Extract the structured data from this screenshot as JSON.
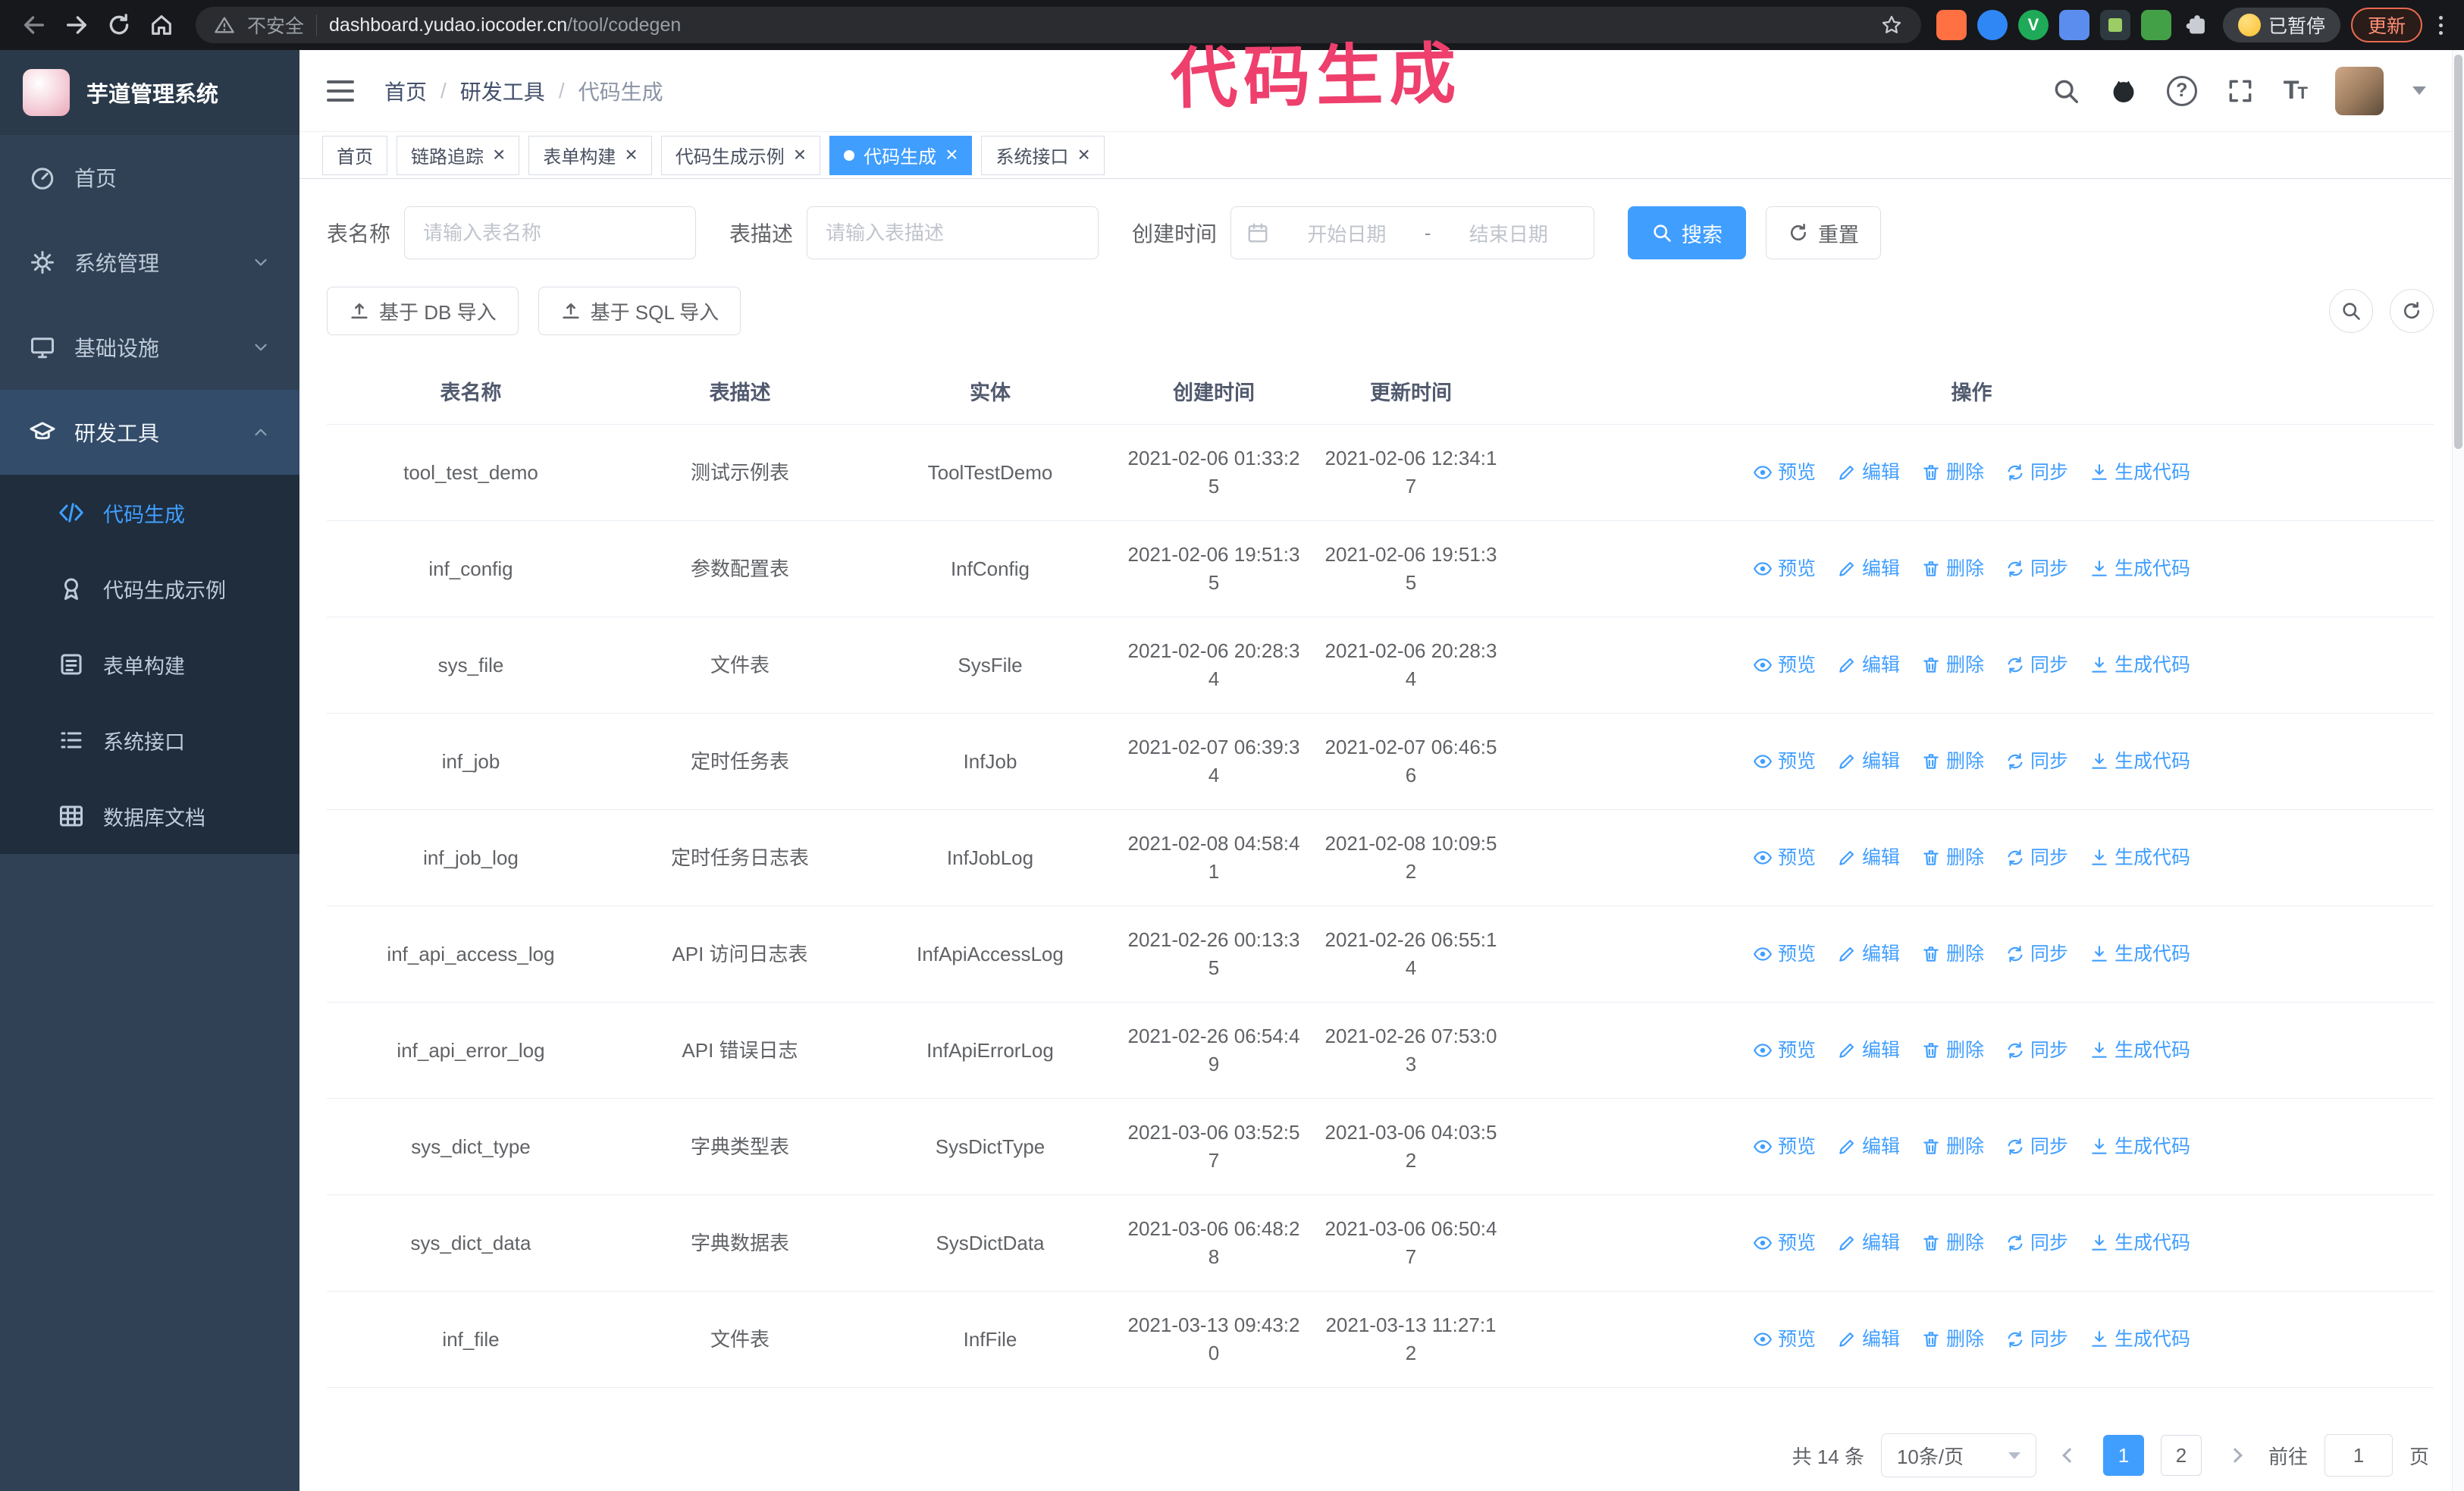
{
  "browser": {
    "security_label": "不安全",
    "url_domain": "dashboard.yudao.iocoder.cn",
    "url_path": "/tool/codegen",
    "paused_badge_label": "已暂停",
    "update_button_label": "更新"
  },
  "annotation": {
    "text": "代码生成",
    "color": "#ee3f6d"
  },
  "sidebar": {
    "logo_title": "芋道管理系统",
    "items": [
      {
        "label": "首页"
      },
      {
        "label": "系统管理"
      },
      {
        "label": "基础设施"
      },
      {
        "label": "研发工具"
      }
    ],
    "submenu": [
      {
        "label": "代码生成",
        "active": true
      },
      {
        "label": "代码生成示例"
      },
      {
        "label": "表单构建"
      },
      {
        "label": "系统接口"
      },
      {
        "label": "数据库文档"
      }
    ]
  },
  "header": {
    "breadcrumb": {
      "items": [
        "首页",
        "研发工具",
        "代码生成"
      ],
      "separator": "/"
    }
  },
  "tabs": [
    {
      "label": "首页"
    },
    {
      "label": "链路追踪",
      "closable": true
    },
    {
      "label": "表单构建",
      "closable": true
    },
    {
      "label": "代码生成示例",
      "closable": true
    },
    {
      "label": "代码生成",
      "closable": true,
      "active": true
    },
    {
      "label": "系统接口",
      "closable": true
    }
  ],
  "filters": {
    "table_name_label": "表名称",
    "table_name_placeholder": "请输入表名称",
    "table_desc_label": "表描述",
    "table_desc_placeholder": "请输入表描述",
    "create_time_label": "创建时间",
    "date_start_placeholder": "开始日期",
    "date_separator": "-",
    "date_end_placeholder": "结束日期",
    "search_button_label": "搜索",
    "reset_button_label": "重置"
  },
  "toolbar": {
    "import_db_label": "基于 DB 导入",
    "import_sql_label": "基于 SQL 导入"
  },
  "table": {
    "columns": [
      "表名称",
      "表描述",
      "实体",
      "创建时间",
      "更新时间",
      "操作"
    ],
    "action_labels": [
      "预览",
      "编辑",
      "删除",
      "同步",
      "生成代码"
    ],
    "rows": [
      {
        "name": "tool_test_demo",
        "desc": "测试示例表",
        "entity": "ToolTestDemo",
        "created": "2021-02-06 01:33:25",
        "updated": "2021-02-06 12:34:17"
      },
      {
        "name": "inf_config",
        "desc": "参数配置表",
        "entity": "InfConfig",
        "created": "2021-02-06 19:51:35",
        "updated": "2021-02-06 19:51:35"
      },
      {
        "name": "sys_file",
        "desc": "文件表",
        "entity": "SysFile",
        "created": "2021-02-06 20:28:34",
        "updated": "2021-02-06 20:28:34"
      },
      {
        "name": "inf_job",
        "desc": "定时任务表",
        "entity": "InfJob",
        "created": "2021-02-07 06:39:34",
        "updated": "2021-02-07 06:46:56"
      },
      {
        "name": "inf_job_log",
        "desc": "定时任务日志表",
        "entity": "InfJobLog",
        "created": "2021-02-08 04:58:41",
        "updated": "2021-02-08 10:09:52"
      },
      {
        "name": "inf_api_access_log",
        "desc": "API 访问日志表",
        "entity": "InfApiAccessLog",
        "created": "2021-02-26 00:13:35",
        "updated": "2021-02-26 06:55:14"
      },
      {
        "name": "inf_api_error_log",
        "desc": "API 错误日志",
        "entity": "InfApiErrorLog",
        "created": "2021-02-26 06:54:49",
        "updated": "2021-02-26 07:53:03"
      },
      {
        "name": "sys_dict_type",
        "desc": "字典类型表",
        "entity": "SysDictType",
        "created": "2021-03-06 03:52:57",
        "updated": "2021-03-06 04:03:52"
      },
      {
        "name": "sys_dict_data",
        "desc": "字典数据表",
        "entity": "SysDictData",
        "created": "2021-03-06 06:48:28",
        "updated": "2021-03-06 06:50:47"
      },
      {
        "name": "inf_file",
        "desc": "文件表",
        "entity": "InfFile",
        "created": "2021-03-13 09:43:20",
        "updated": "2021-03-13 11:27:12"
      }
    ]
  },
  "pagination": {
    "total_label": "共 14 条",
    "page_size_label": "10条/页",
    "pages": [
      "1",
      "2"
    ],
    "active_page": "1",
    "goto_prefix": "前往",
    "goto_value": "1",
    "goto_suffix": "页"
  },
  "icons": {
    "close": "×"
  },
  "colors": {
    "primary": "#409eff",
    "annotation": "#ee3f6d",
    "sidebar_bg": "#304156",
    "submenu_bg": "#1f2d3d",
    "chrome_bg": "#17181b"
  }
}
